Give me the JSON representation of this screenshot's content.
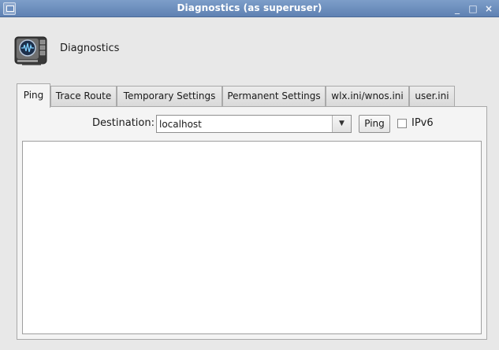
{
  "window": {
    "title": "Diagnostics (as superuser)",
    "minimize_glyph": "_",
    "maximize_glyph": "□",
    "close_glyph": "×"
  },
  "header": {
    "icon": "diagnostics-app-icon",
    "title": "Diagnostics"
  },
  "tabs": [
    {
      "label": "Ping",
      "active": true
    },
    {
      "label": "Trace Route",
      "active": false
    },
    {
      "label": "Temporary Settings",
      "active": false
    },
    {
      "label": "Permanent Settings",
      "active": false
    },
    {
      "label": "wlx.ini/wnos.ini",
      "active": false
    },
    {
      "label": "user.ini",
      "active": false
    }
  ],
  "ping": {
    "destination_label": "Destination:",
    "destination_value": "localhost",
    "ping_button": "Ping",
    "ipv6_label": "IPv6",
    "ipv6_checked": false,
    "output": ""
  }
}
